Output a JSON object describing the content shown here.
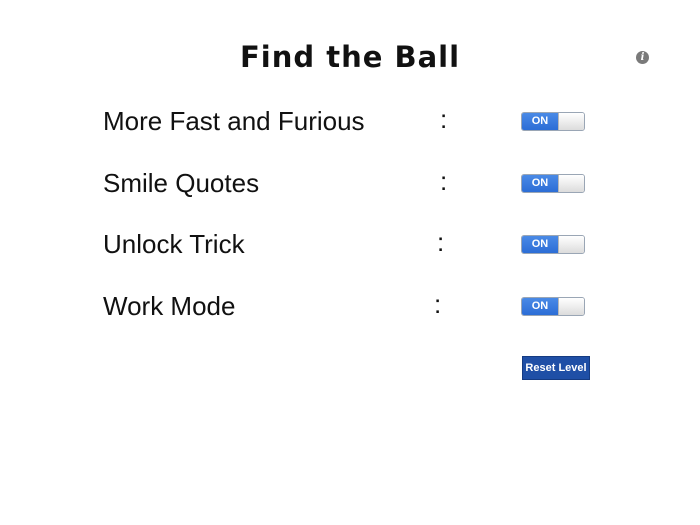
{
  "header": {
    "title": "Find the Ball",
    "info_icon": "info-icon",
    "info_glyph": "i"
  },
  "settings": {
    "items": [
      {
        "label": "More Fast and Furious",
        "colon": ":",
        "toggle_text": "ON",
        "toggle_state": "on"
      },
      {
        "label": "Smile Quotes",
        "colon": ":",
        "toggle_text": "ON",
        "toggle_state": "on"
      },
      {
        "label": "Unlock Trick",
        "colon": ":",
        "toggle_text": "ON",
        "toggle_state": "on"
      },
      {
        "label": "Work Mode",
        "colon": ":",
        "toggle_text": "ON",
        "toggle_state": "on"
      }
    ]
  },
  "actions": {
    "reset_label": "Reset Level"
  },
  "colors": {
    "toggle_on": "#2c6dd6",
    "reset_button": "#1f4fa6",
    "info_icon": "#7a7a7a"
  }
}
